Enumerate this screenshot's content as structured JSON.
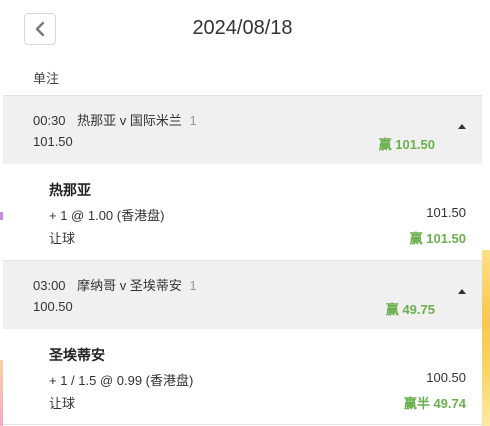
{
  "header": {
    "title": "2024/08/18"
  },
  "section_label": "单注",
  "bets": [
    {
      "time": "00:30",
      "match": "热那亚 v 国际米兰",
      "count": "1",
      "stake": "101.50",
      "result": "赢 101.50",
      "team": "热那亚",
      "odds": "+ 1 @ 1.00 (香港盘)",
      "amount": "101.50",
      "bet_type": "让球",
      "win": "赢 101.50"
    },
    {
      "time": "03:00",
      "match": "摩纳哥 v 圣埃蒂安",
      "count": "1",
      "stake": "100.50",
      "result": "赢 49.75",
      "team": "圣埃蒂安",
      "odds": "+ 1 / 1.5 @ 0.99 (香港盘)",
      "amount": "100.50",
      "bet_type": "让球",
      "win": "赢半 49.74"
    }
  ],
  "colors": {
    "win_green": "#6ab04c",
    "row_bg": "#f0f0f0"
  },
  "icons": {
    "back": "chevron-left-icon",
    "collapse": "caret-up-icon"
  }
}
